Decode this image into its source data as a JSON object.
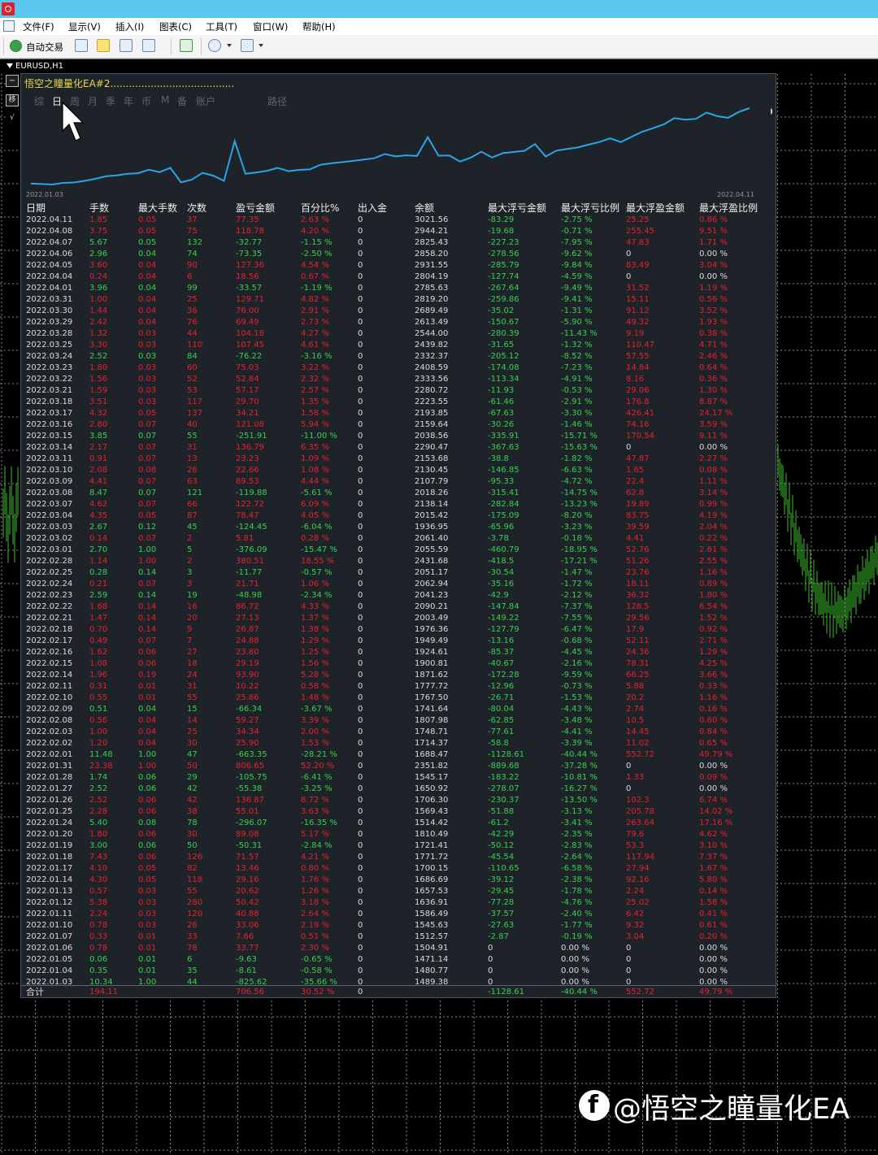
{
  "window": {
    "titlebar_color": "#5bc6ee"
  },
  "menu": [
    "文件(F)",
    "显示(V)",
    "插入(I)",
    "图表(C)",
    "工具(T)",
    "窗口(W)",
    "帮助(H)"
  ],
  "toolbar": {
    "auto_trade": "自动交易"
  },
  "chart": {
    "symbol": "EURUSD,H1"
  },
  "panel": {
    "title": "悟空之瞳量化EA#2........................................",
    "tabs": [
      "综",
      "日",
      "周",
      "月",
      "季",
      "年",
      "币",
      "M",
      "备",
      "账户",
      "路径"
    ],
    "active_tab": "日",
    "equity_start_date": "2022.01.03",
    "equity_end_date": "2022.04.11"
  },
  "table": {
    "headers": [
      "日期",
      "手数",
      "最大手数",
      "次数",
      "盈亏金额",
      "百分比%",
      "出入金",
      "余额",
      "最大浮亏金额",
      "最大浮亏比例",
      "最大浮盈金额",
      "最大浮盈比例"
    ],
    "rows": [
      [
        "2022.04.11",
        "1.85",
        "0.05",
        "37",
        "77.35",
        "2.63 %",
        "0",
        "3021.56",
        "-83.29",
        "-2.75 %",
        "25.25",
        "0.86 %"
      ],
      [
        "2022.04.08",
        "3.75",
        "0.05",
        "75",
        "118.78",
        "4.20 %",
        "0",
        "2944.21",
        "-19.68",
        "-0.71 %",
        "255.45",
        "9.51 %"
      ],
      [
        "2022.04.07",
        "5.67",
        "0.05",
        "132",
        "-32.77",
        "-1.15 %",
        "0",
        "2825.43",
        "-227.23",
        "-7.95 %",
        "47.83",
        "1.71 %"
      ],
      [
        "2022.04.06",
        "2.96",
        "0.04",
        "74",
        "-73.35",
        "-2.50 %",
        "0",
        "2858.20",
        "-278.56",
        "-9.62 %",
        "0",
        "0.00 %"
      ],
      [
        "2022.04.05",
        "3.60",
        "0.04",
        "90",
        "127.36",
        "4.54 %",
        "0",
        "2931.55",
        "-285.79",
        "-9.84 %",
        "83.49",
        "3.04 %"
      ],
      [
        "2022.04.04",
        "0.24",
        "0.04",
        "6",
        "18.56",
        "0.67 %",
        "0",
        "2804.19",
        "-127.74",
        "-4.59 %",
        "0",
        "0.00 %"
      ],
      [
        "2022.04.01",
        "3.96",
        "0.04",
        "99",
        "-33.57",
        "-1.19 %",
        "0",
        "2785.63",
        "-267.64",
        "-9.49 %",
        "31.52",
        "1.19 %"
      ],
      [
        "2022.03.31",
        "1.00",
        "0.04",
        "25",
        "129.71",
        "4.82 %",
        "0",
        "2819.20",
        "-259.86",
        "-9.41 %",
        "15.11",
        "0.56 %"
      ],
      [
        "2022.03.30",
        "1.44",
        "0.04",
        "36",
        "76.00",
        "2.91 %",
        "0",
        "2689.49",
        "-35.02",
        "-1.31 %",
        "91.12",
        "3.52 %"
      ],
      [
        "2022.03.29",
        "2.42",
        "0.04",
        "76",
        "69.49",
        "2.73 %",
        "0",
        "2613.49",
        "-150.67",
        "-5.90 %",
        "49.32",
        "1.93 %"
      ],
      [
        "2022.03.28",
        "1.32",
        "0.03",
        "44",
        "104.18",
        "4.27 %",
        "0",
        "2544.00",
        "-280.39",
        "-11.43 %",
        "9.19",
        "0.38 %"
      ],
      [
        "2022.03.25",
        "3.30",
        "0.03",
        "110",
        "107.45",
        "4.61 %",
        "0",
        "2439.82",
        "-31.65",
        "-1.32 %",
        "110.47",
        "4.71 %"
      ],
      [
        "2022.03.24",
        "2.52",
        "0.03",
        "84",
        "-76.22",
        "-3.16 %",
        "0",
        "2332.37",
        "-205.12",
        "-8.52 %",
        "57.55",
        "2.46 %"
      ],
      [
        "2022.03.23",
        "1.80",
        "0.03",
        "60",
        "75.03",
        "3.22 %",
        "0",
        "2408.59",
        "-174.08",
        "-7.23 %",
        "14.84",
        "0.64 %"
      ],
      [
        "2022.03.22",
        "1.56",
        "0.03",
        "52",
        "52.84",
        "2.32 %",
        "0",
        "2333.56",
        "-113.34",
        "-4.91 %",
        "8.16",
        "0.36 %"
      ],
      [
        "2022.03.21",
        "1.59",
        "0.03",
        "53",
        "57.17",
        "2.57 %",
        "0",
        "2280.72",
        "-11.93",
        "-0.53 %",
        "29.06",
        "1.30 %"
      ],
      [
        "2022.03.18",
        "3.51",
        "0.03",
        "117",
        "29.70",
        "1.35 %",
        "0",
        "2223.55",
        "-61.46",
        "-2.91 %",
        "176.8",
        "8.87 %"
      ],
      [
        "2022.03.17",
        "4.32",
        "0.05",
        "137",
        "34.21",
        "1.58 %",
        "0",
        "2193.85",
        "-67.63",
        "-3.30 %",
        "426.41",
        "24.17 %"
      ],
      [
        "2022.03.16",
        "2.80",
        "0.07",
        "40",
        "121.08",
        "5.94 %",
        "0",
        "2159.64",
        "-30.26",
        "-1.46 %",
        "74.16",
        "3.59 %"
      ],
      [
        "2022.03.15",
        "3.85",
        "0.07",
        "55",
        "-251.91",
        "-11.00 %",
        "0",
        "2038.56",
        "-335.91",
        "-15.71 %",
        "170.54",
        "9.11 %"
      ],
      [
        "2022.03.14",
        "2.17",
        "0.07",
        "31",
        "136.79",
        "6.35 %",
        "0",
        "2290.47",
        "-367.63",
        "-15.63 %",
        "0",
        "0.00 %"
      ],
      [
        "2022.03.11",
        "0.91",
        "0.07",
        "13",
        "23.23",
        "1.09 %",
        "0",
        "2153.68",
        "-38.8",
        "-1.82 %",
        "47.87",
        "2.27 %"
      ],
      [
        "2022.03.10",
        "2.08",
        "0.08",
        "26",
        "22.66",
        "1.08 %",
        "0",
        "2130.45",
        "-146.85",
        "-6.63 %",
        "1.65",
        "0.08 %"
      ],
      [
        "2022.03.09",
        "4.41",
        "0.07",
        "63",
        "89.53",
        "4.44 %",
        "0",
        "2107.79",
        "-95.33",
        "-4.72 %",
        "22.4",
        "1.11 %"
      ],
      [
        "2022.03.08",
        "8.47",
        "0.07",
        "121",
        "-119.88",
        "-5.61 %",
        "0",
        "2018.26",
        "-315.41",
        "-14.75 %",
        "62.8",
        "3.14 %"
      ],
      [
        "2022.03.07",
        "4.62",
        "0.07",
        "66",
        "122.72",
        "6.09 %",
        "0",
        "2138.14",
        "-282.84",
        "-13.23 %",
        "19.89",
        "0.99 %"
      ],
      [
        "2022.03.04",
        "4.35",
        "0.05",
        "87",
        "78.47",
        "4.05 %",
        "0",
        "2015.42",
        "-175.09",
        "-8.20 %",
        "83.75",
        "4.19 %"
      ],
      [
        "2022.03.03",
        "2.67",
        "0.12",
        "45",
        "-124.45",
        "-6.04 %",
        "0",
        "1936.95",
        "-65.96",
        "-3.23 %",
        "39.59",
        "2.04 %"
      ],
      [
        "2022.03.02",
        "0.14",
        "0.07",
        "2",
        "5.81",
        "0.28 %",
        "0",
        "2061.40",
        "-3.78",
        "-0.18 %",
        "4.41",
        "0.22 %"
      ],
      [
        "2022.03.01",
        "2.70",
        "1.00",
        "5",
        "-376.09",
        "-15.47 %",
        "0",
        "2055.59",
        "-460.79",
        "-18.95 %",
        "52.76",
        "2.61 %"
      ],
      [
        "2022.02.28",
        "1.14",
        "1.00",
        "2",
        "380.51",
        "18.55 %",
        "0",
        "2431.68",
        "-418.5",
        "-17.21 %",
        "51.26",
        "2.55 %"
      ],
      [
        "2022.02.25",
        "0.28",
        "0.14",
        "3",
        "-11.77",
        "-0.57 %",
        "0",
        "2051.17",
        "-30.54",
        "-1.47 %",
        "23.76",
        "1.16 %"
      ],
      [
        "2022.02.24",
        "0.21",
        "0.07",
        "3",
        "21.71",
        "1.06 %",
        "0",
        "2062.94",
        "-35.16",
        "-1.72 %",
        "18.11",
        "0.89 %"
      ],
      [
        "2022.02.23",
        "2.59",
        "0.14",
        "19",
        "-48.98",
        "-2.34 %",
        "0",
        "2041.23",
        "-42.9",
        "-2.12 %",
        "36.32",
        "1.80 %"
      ],
      [
        "2022.02.22",
        "1.68",
        "0.14",
        "16",
        "86.72",
        "4.33 %",
        "0",
        "2090.21",
        "-147.84",
        "-7.37 %",
        "128.5",
        "6.54 %"
      ],
      [
        "2022.02.21",
        "1.47",
        "0.14",
        "20",
        "27.13",
        "1.37 %",
        "0",
        "2003.49",
        "-149.22",
        "-7.55 %",
        "29.56",
        "1.52 %"
      ],
      [
        "2022.02.18",
        "0.70",
        "0.14",
        "9",
        "26.87",
        "1.38 %",
        "0",
        "1976.36",
        "-127.79",
        "-6.47 %",
        "17.9",
        "0.92 %"
      ],
      [
        "2022.02.17",
        "0.49",
        "0.07",
        "7",
        "24.88",
        "1.29 %",
        "0",
        "1949.49",
        "-13.16",
        "-0.68 %",
        "52.11",
        "2.71 %"
      ],
      [
        "2022.02.16",
        "1.62",
        "0.06",
        "27",
        "23.80",
        "1.25 %",
        "0",
        "1924.61",
        "-85.37",
        "-4.45 %",
        "24.36",
        "1.29 %"
      ],
      [
        "2022.02.15",
        "1.08",
        "0.06",
        "18",
        "29.19",
        "1.56 %",
        "0",
        "1900.81",
        "-40.67",
        "-2.16 %",
        "78.31",
        "4.25 %"
      ],
      [
        "2022.02.14",
        "1.96",
        "0.19",
        "24",
        "93.90",
        "5.28 %",
        "0",
        "1871.62",
        "-172.28",
        "-9.59 %",
        "66.25",
        "3.66 %"
      ],
      [
        "2022.02.11",
        "0.31",
        "0.01",
        "31",
        "10.22",
        "0.58 %",
        "0",
        "1777.72",
        "-12.96",
        "-0.73 %",
        "5.88",
        "0.33 %"
      ],
      [
        "2022.02.10",
        "0.55",
        "0.01",
        "55",
        "25.86",
        "1.48 %",
        "0",
        "1767.50",
        "-26.71",
        "-1.53 %",
        "20.2",
        "1.16 %"
      ],
      [
        "2022.02.09",
        "0.51",
        "0.04",
        "15",
        "-66.34",
        "-3.67 %",
        "0",
        "1741.64",
        "-80.04",
        "-4.43 %",
        "2.74",
        "0.16 %"
      ],
      [
        "2022.02.08",
        "0.56",
        "0.04",
        "14",
        "59.27",
        "3.39 %",
        "0",
        "1807.98",
        "-62.85",
        "-3.48 %",
        "10.5",
        "0.60 %"
      ],
      [
        "2022.02.03",
        "1.00",
        "0.04",
        "25",
        "34.34",
        "2.00 %",
        "0",
        "1748.71",
        "-77.61",
        "-4.41 %",
        "14.45",
        "0.84 %"
      ],
      [
        "2022.02.02",
        "1.20",
        "0.04",
        "30",
        "25.90",
        "1.53 %",
        "0",
        "1714.37",
        "-58.8",
        "-3.39 %",
        "11.02",
        "0.65 %"
      ],
      [
        "2022.02.01",
        "11.48",
        "1.00",
        "47",
        "-663.35",
        "-28.21 %",
        "0",
        "1688.47",
        "-1128.61",
        "-40.44 %",
        "552.72",
        "49.79 %"
      ],
      [
        "2022.01.31",
        "23.38",
        "1.00",
        "50",
        "806.65",
        "52.20 %",
        "0",
        "2351.82",
        "-889.68",
        "-37.28 %",
        "0",
        "0.00 %"
      ],
      [
        "2022.01.28",
        "1.74",
        "0.06",
        "29",
        "-105.75",
        "-6.41 %",
        "0",
        "1545.17",
        "-183.22",
        "-10.81 %",
        "1.33",
        "0.09 %"
      ],
      [
        "2022.01.27",
        "2.52",
        "0.06",
        "42",
        "-55.38",
        "-3.25 %",
        "0",
        "1650.92",
        "-278.07",
        "-16.27 %",
        "0",
        "0.00 %"
      ],
      [
        "2022.01.26",
        "2.52",
        "0.06",
        "42",
        "136.87",
        "8.72 %",
        "0",
        "1706.30",
        "-230.37",
        "-13.50 %",
        "102.3",
        "6.74 %"
      ],
      [
        "2022.01.25",
        "2.28",
        "0.06",
        "38",
        "55.01",
        "3.63 %",
        "0",
        "1569.43",
        "-51.88",
        "-3.13 %",
        "205.78",
        "14.02 %"
      ],
      [
        "2022.01.24",
        "5.40",
        "0.08",
        "78",
        "-296.07",
        "-16.35 %",
        "0",
        "1514.42",
        "-61.2",
        "-3.41 %",
        "263.64",
        "17.16 %"
      ],
      [
        "2022.01.20",
        "1.80",
        "0.06",
        "30",
        "89.08",
        "5.17 %",
        "0",
        "1810.49",
        "-42.29",
        "-2.35 %",
        "79.6",
        "4.62 %"
      ],
      [
        "2022.01.19",
        "3.00",
        "0.06",
        "50",
        "-50.31",
        "-2.84 %",
        "0",
        "1721.41",
        "-50.12",
        "-2.83 %",
        "53.3",
        "3.10 %"
      ],
      [
        "2022.01.18",
        "7.43",
        "0.06",
        "126",
        "71.57",
        "4.21 %",
        "0",
        "1771.72",
        "-45.54",
        "-2.64 %",
        "117.94",
        "7.37 %"
      ],
      [
        "2022.01.17",
        "4.10",
        "0.05",
        "82",
        "13.46",
        "0.80 %",
        "0",
        "1700.15",
        "-110.65",
        "-6.58 %",
        "27.94",
        "1.67 %"
      ],
      [
        "2022.01.14",
        "4.30",
        "0.05",
        "118",
        "29.16",
        "1.76 %",
        "0",
        "1686.69",
        "-39.12",
        "-2.38 %",
        "92.16",
        "5.80 %"
      ],
      [
        "2022.01.13",
        "0.57",
        "0.03",
        "55",
        "20.62",
        "1.26 %",
        "0",
        "1657.53",
        "-29.45",
        "-1.78 %",
        "2.24",
        "0.14 %"
      ],
      [
        "2022.01.12",
        "5.38",
        "0.03",
        "280",
        "50.42",
        "3.18 %",
        "0",
        "1636.91",
        "-77.28",
        "-4.76 %",
        "25.02",
        "1.58 %"
      ],
      [
        "2022.01.11",
        "2.24",
        "0.03",
        "120",
        "40.88",
        "2.64 %",
        "0",
        "1586.49",
        "-37.57",
        "-2.40 %",
        "6.42",
        "0.41 %"
      ],
      [
        "2022.01.10",
        "0.78",
        "0.03",
        "26",
        "33.06",
        "2.19 %",
        "0",
        "1545.63",
        "-27.63",
        "-1.77 %",
        "9.32",
        "0.61 %"
      ],
      [
        "2022.01.07",
        "0.33",
        "0.01",
        "33",
        "7.66",
        "0.51 %",
        "0",
        "1512.57",
        "-2.87",
        "-0.19 %",
        "3.04",
        "0.20 %"
      ],
      [
        "2022.01.06",
        "0.78",
        "0.01",
        "78",
        "33.77",
        "2.30 %",
        "0",
        "1504.91",
        "0",
        "0.00 %",
        "0",
        "0.00 %"
      ],
      [
        "2022.01.05",
        "0.06",
        "0.01",
        "6",
        "-9.63",
        "-0.65 %",
        "0",
        "1471.14",
        "0",
        "0.00 %",
        "0",
        "0.00 %"
      ],
      [
        "2022.01.04",
        "0.35",
        "0.01",
        "35",
        "-8.61",
        "-0.58 %",
        "0",
        "1480.77",
        "0",
        "0.00 %",
        "0",
        "0.00 %"
      ],
      [
        "2022.01.03",
        "10.34",
        "1.00",
        "44",
        "-825.62",
        "-35.66 %",
        "0",
        "1489.38",
        "0",
        "0.00 %",
        "0",
        "0.00 %"
      ]
    ],
    "total": [
      "合计",
      "194.11",
      "",
      "",
      "706.56",
      "30.52 %",
      "0",
      "",
      "-1128.61",
      "-40.44 %",
      "552.72",
      "49.79 %"
    ]
  },
  "watermark": {
    "text": "@悟空之瞳量化EA"
  },
  "colors": {
    "profit": "#e8212a",
    "loss": "#37d24b",
    "neutral": "#dcdcdc",
    "title": "#e8d84a",
    "equity_line": "#2aa4e6",
    "panel_bg": "#1e232a"
  }
}
